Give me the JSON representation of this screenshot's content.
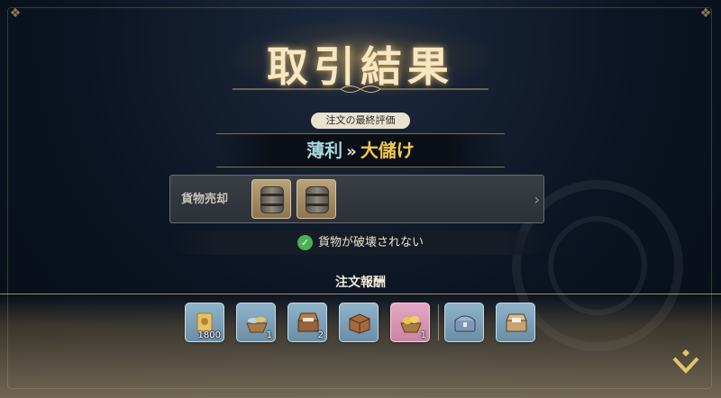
{
  "result": {
    "title": "取引結果"
  },
  "evaluation": {
    "label": "注文の最終評価",
    "from": "薄利",
    "arrow": "»",
    "to": "大儲け"
  },
  "cargo": {
    "label": "貨物売却",
    "items": [
      {
        "icon": "barrel-icon"
      },
      {
        "icon": "barrel-icon"
      }
    ]
  },
  "status": {
    "text": "貨物が破壊されない",
    "icon": "check-icon"
  },
  "rewards": {
    "title": "注文報酬",
    "items": [
      {
        "icon": "ticket-icon",
        "count": "1800"
      },
      {
        "icon": "fish-basket-icon",
        "count": "1"
      },
      {
        "icon": "open-chest-icon",
        "count": "2"
      },
      {
        "icon": "wooden-crate-icon",
        "count": ""
      },
      {
        "icon": "fruit-basket-icon",
        "count": "1"
      },
      {
        "icon": "silver-chest-icon",
        "count": ""
      },
      {
        "icon": "treasure-chest-icon",
        "count": ""
      }
    ]
  },
  "colors": {
    "background": "#0b1422",
    "accent_gold": "#f2c84b",
    "eval_from": "#a6d6d8",
    "check_green": "#4caf50"
  }
}
